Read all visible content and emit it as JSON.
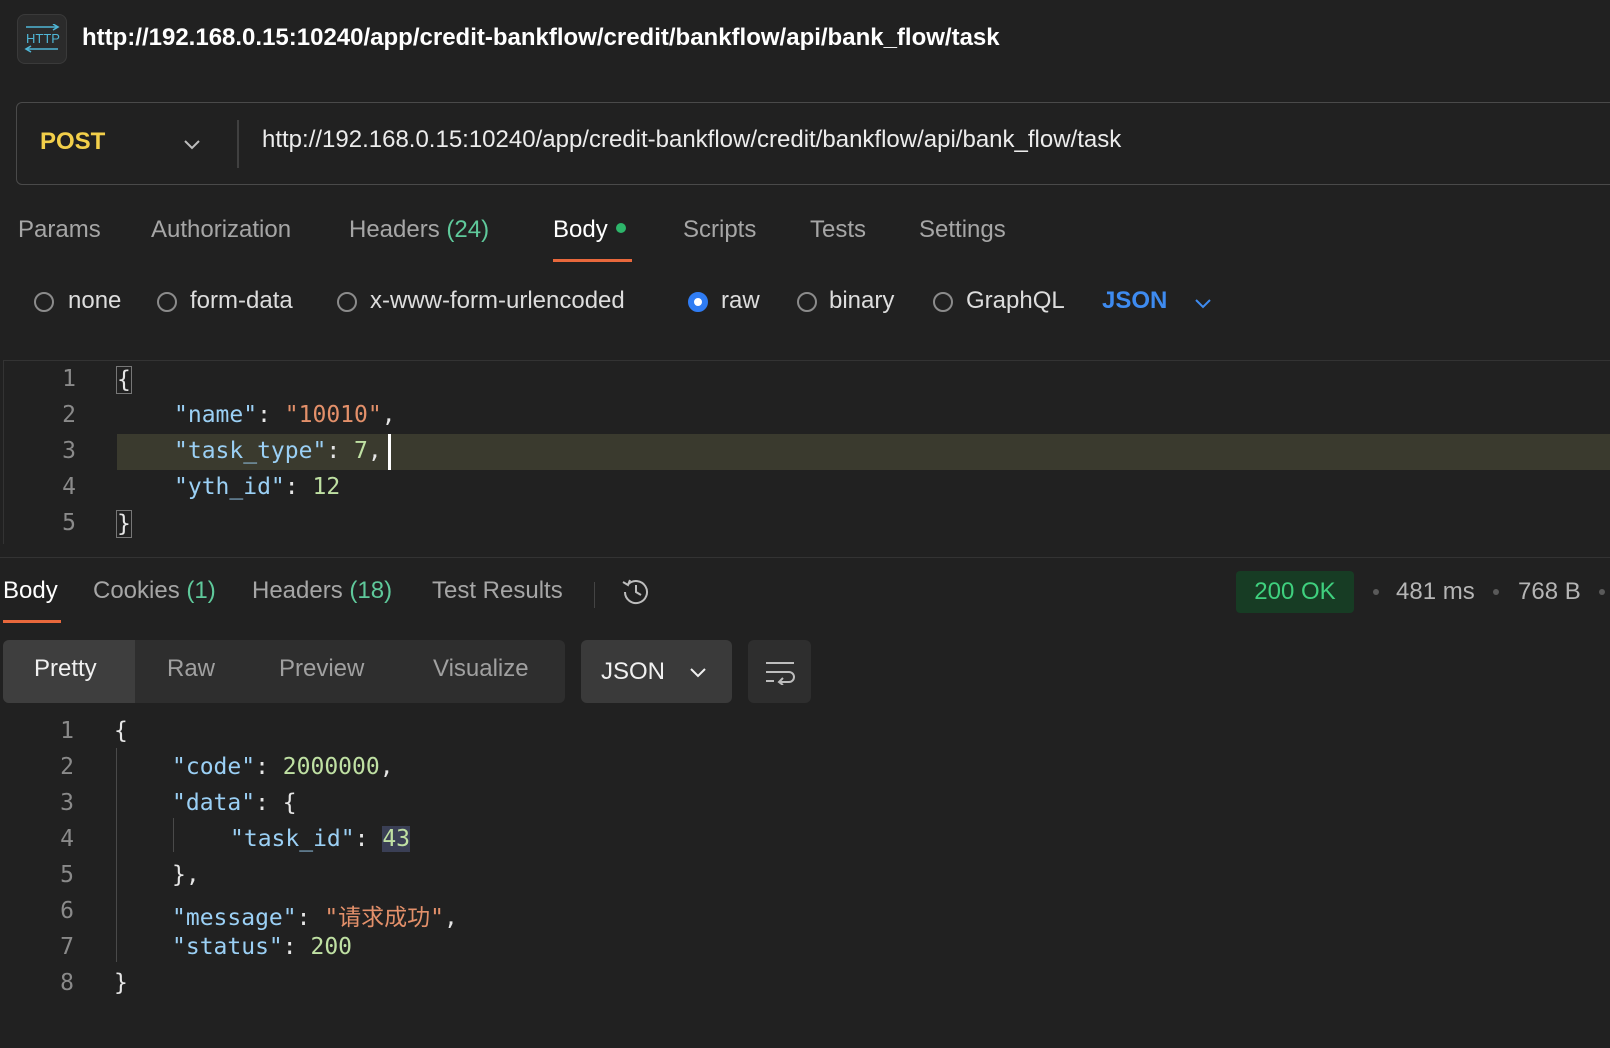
{
  "title": {
    "badge": "HTTP",
    "url": "http://192.168.0.15:10240/app/credit-bankflow/credit/bankflow/api/bank_flow/task"
  },
  "request": {
    "method": "POST",
    "url": "http://192.168.0.15:10240/app/credit-bankflow/credit/bankflow/api/bank_flow/task",
    "tabs": {
      "params": "Params",
      "authorization": "Authorization",
      "headers": "Headers",
      "headers_count": "(24)",
      "body": "Body",
      "scripts": "Scripts",
      "tests": "Tests",
      "settings": "Settings"
    },
    "body_types": {
      "none": "none",
      "form_data": "form-data",
      "urlencoded": "x-www-form-urlencoded",
      "raw": "raw",
      "binary": "binary",
      "graphql": "GraphQL",
      "selected": "raw"
    },
    "raw_type": "JSON",
    "body_lines": [
      {
        "num": "1",
        "text": "{"
      },
      {
        "num": "2",
        "key": "\"name\"",
        "colon": ": ",
        "value": "\"10010\"",
        "tail": ","
      },
      {
        "num": "3",
        "key": "\"task_type\"",
        "colon": ": ",
        "value": "7",
        "tail": ","
      },
      {
        "num": "4",
        "key": "\"yth_id\"",
        "colon": ": ",
        "value": "12",
        "tail": ""
      },
      {
        "num": "5",
        "text": "}"
      }
    ]
  },
  "response": {
    "tabs": {
      "body": "Body",
      "cookies": "Cookies",
      "cookies_count": "(1)",
      "headers": "Headers",
      "headers_count": "(18)",
      "test_results": "Test Results"
    },
    "status": "200 OK",
    "time": "481 ms",
    "size": "768 B",
    "views": {
      "pretty": "Pretty",
      "raw": "Raw",
      "preview": "Preview",
      "visualize": "Visualize"
    },
    "format": "JSON",
    "lines": {
      "l1": {
        "num": "1",
        "text": "{"
      },
      "l2": {
        "num": "2",
        "key": "\"code\"",
        "colon": ": ",
        "value": "2000000",
        "tail": ","
      },
      "l3": {
        "num": "3",
        "key": "\"data\"",
        "colon": ": ",
        "tail": "{"
      },
      "l4": {
        "num": "4",
        "key": "\"task_id\"",
        "colon": ": ",
        "value": "43"
      },
      "l5": {
        "num": "5",
        "text": "},"
      },
      "l6": {
        "num": "6",
        "key": "\"message\"",
        "colon": ": ",
        "value": "\"请求成功\"",
        "tail": ","
      },
      "l7": {
        "num": "7",
        "key": "\"status\"",
        "colon": ": ",
        "value": "200"
      },
      "l8": {
        "num": "8",
        "text": "}"
      }
    }
  },
  "colors": {
    "method": "#f2cf4a",
    "accent_underline": "#e8683c",
    "json_key": "#9bd0f5",
    "json_string": "#e3906a",
    "json_number": "#bfe0a3",
    "status_ok": "#3fd07e"
  },
  "icons": [
    "http-icon",
    "chevron-down-icon",
    "history-icon",
    "wrap-lines-icon"
  ]
}
